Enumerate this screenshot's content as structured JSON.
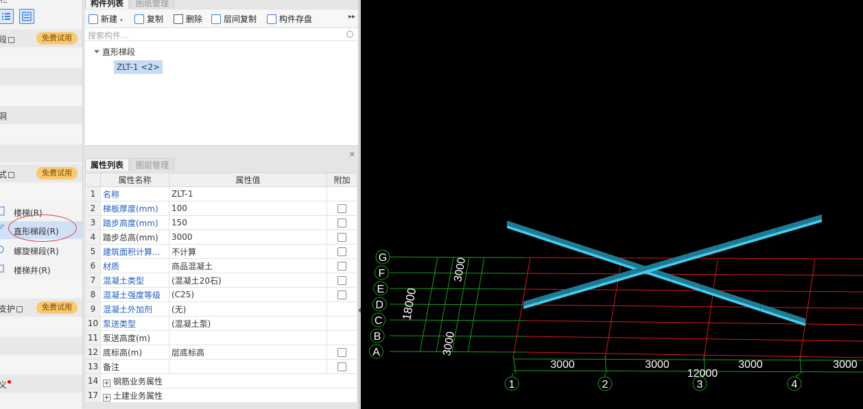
{
  "left_nav": {
    "top_label": "栏",
    "sections": [
      {
        "label": "段",
        "trial": "免费试用"
      },
      {
        "label": "洞"
      },
      {
        "label": "式",
        "trial": "免费试用"
      },
      {
        "label": "支护",
        "trial": "免费试用"
      },
      {
        "label": "义"
      }
    ],
    "items": [
      {
        "label": "楼梯(R)"
      },
      {
        "label": "直形梯段(R)"
      },
      {
        "label": "螺旋梯段(R)"
      },
      {
        "label": "楼梯井(R)"
      }
    ]
  },
  "component_panel": {
    "tabs": [
      "构件列表",
      "图纸管理"
    ],
    "toolbar": {
      "new": "新建",
      "copy": "复制",
      "delete": "删除",
      "floor_copy": "层间复制",
      "save": "构件存盘"
    },
    "search_placeholder": "搜索构件...",
    "tree": {
      "root": "直形梯段",
      "leaf": "ZLT-1 <2>"
    }
  },
  "property_panel": {
    "tabs": [
      "属性列表",
      "图层管理"
    ],
    "headers": [
      "属性名称",
      "属性值",
      "附加"
    ],
    "rows": [
      {
        "no": "1",
        "name": "名称",
        "value": "ZLT-1",
        "blue": true,
        "check": false
      },
      {
        "no": "2",
        "name": "梯板厚度(mm)",
        "value": "100",
        "blue": true,
        "check": true
      },
      {
        "no": "3",
        "name": "踏步高度(mm)",
        "value": "150",
        "blue": true,
        "check": true
      },
      {
        "no": "4",
        "name": "踏步总高(mm)",
        "value": "3000",
        "blue": false,
        "check": true
      },
      {
        "no": "5",
        "name": "建筑面积计算...",
        "value": "不计算",
        "blue": true,
        "check": true
      },
      {
        "no": "6",
        "name": "材质",
        "value": "商品混凝土",
        "blue": true,
        "check": true
      },
      {
        "no": "7",
        "name": "混凝土类型",
        "value": "(混凝土20石)",
        "blue": true,
        "check": true
      },
      {
        "no": "8",
        "name": "混凝土强度等级",
        "value": "(C25)",
        "blue": true,
        "check": true
      },
      {
        "no": "9",
        "name": "混凝土外加剂",
        "value": "(无)",
        "blue": true,
        "check": false
      },
      {
        "no": "10",
        "name": "泵送类型",
        "value": "(混凝土泵)",
        "blue": true,
        "check": false
      },
      {
        "no": "11",
        "name": "泵送高度(m)",
        "value": "",
        "blue": false,
        "check": false
      },
      {
        "no": "12",
        "name": "底标高(m)",
        "value": "层底标高",
        "blue": false,
        "check": true
      },
      {
        "no": "13",
        "name": "备注",
        "value": "",
        "blue": false,
        "check": true
      }
    ],
    "groups": [
      {
        "no": "14",
        "name": "钢筋业务属性"
      },
      {
        "no": "17",
        "name": "土建业务属性"
      }
    ]
  },
  "drawing": {
    "row_axes": [
      "G",
      "F",
      "E",
      "D",
      "C",
      "B",
      "A"
    ],
    "col_axes": [
      "1",
      "2",
      "3",
      "4"
    ],
    "dims_bottom": [
      "3000",
      "3000",
      "3000",
      "3000"
    ],
    "dim_total_bottom": "12000",
    "dim_total_left": "18000",
    "dim_left_stack": "3000",
    "dim_left_stack_bottom": "3000",
    "colors": {
      "grid_green": "#1aa01a",
      "grid_red": "#e01818",
      "stair": "#3fd0ef",
      "stair_dark": "#1f7a93"
    }
  }
}
